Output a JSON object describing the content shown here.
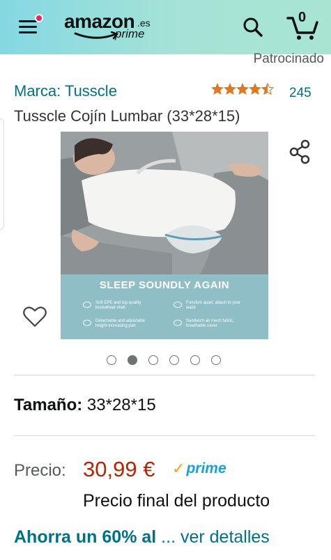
{
  "header": {
    "logo_main": "amazon",
    "logo_tld": ".es",
    "logo_prime": "prime",
    "cart_count": "0",
    "bg_color": "#90dbe0"
  },
  "listing": {
    "sponsored_label": "Patrocinado",
    "brand": "Marca: Tusscle",
    "rating_stars": 4.5,
    "rating_count": "245",
    "title": "Tusscle Cojín Lumbar (33*28*15)"
  },
  "image": {
    "headline": "SLEEP SOUNDLY AGAIN",
    "features": [
      "Soft EPE and top-quality buckwheat shell",
      "Function apart, attach to your waist",
      "Detachable and adjustable height-increasing part",
      "Sandwich air mesh fabric, breathable cover"
    ],
    "carousel_count": 6,
    "carousel_active": 1
  },
  "options": {
    "size_label": "Tamaño:",
    "size_value": "33*28*15"
  },
  "pricing": {
    "price_label": "Precio:",
    "price_value": "30,99 €",
    "prime_word": "prime",
    "price_note": "Precio final del producto",
    "savings_text": "Ahorra un 60% al",
    "savings_more": " ... ver detalles",
    "price_color": "#b12704",
    "link_color": "#007185"
  }
}
